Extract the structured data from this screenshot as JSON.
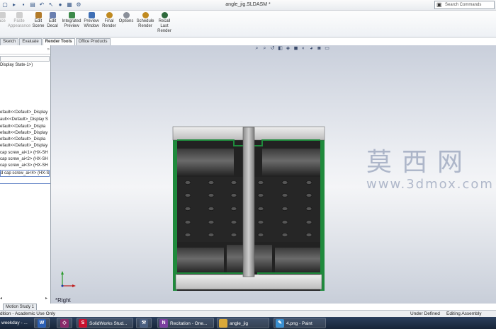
{
  "window": {
    "document_title": "angle_jig.SLDASM *",
    "search_placeholder": "Search Commands"
  },
  "ribbon": {
    "buttons": [
      {
        "label": "ace",
        "disabled": true
      },
      {
        "label": "Paste\nAppearance",
        "disabled": true
      },
      {
        "label": "Edit\nScene",
        "disabled": false
      },
      {
        "label": "Edit\nDecal",
        "disabled": false
      },
      {
        "label": "Integrated\nPreview",
        "disabled": false
      },
      {
        "label": "Preview\nWindow",
        "disabled": false
      },
      {
        "label": "Final\nRender",
        "disabled": false
      },
      {
        "label": "Options",
        "disabled": false
      },
      {
        "label": "Schedule\nRender",
        "disabled": false
      },
      {
        "label": "Recall\nLast\nRender",
        "disabled": false
      }
    ]
  },
  "tabs": [
    "Sketch",
    "Evaluate",
    "Render Tools",
    "Office Products"
  ],
  "active_tab": "Render Tools",
  "feature_tree": {
    "display_state": "Display State-1>)",
    "items": [
      "efault<<Default>_Display",
      "ault<<Default>_Display S",
      "efault<<Default>_Displa",
      "efault<<Default>_Display",
      "efault<<Default>_Displa",
      "efault<<Default>_Display",
      "cap screw_ai<1> (HX-SH",
      "cap screw_ai<2> (HX-SH",
      "cap screw_ai<3> (HX-SH"
    ],
    "selected_item": "d cap screw_ai<4> (HX-S"
  },
  "viewport": {
    "view_name": "*Right",
    "watermark_cn": "莫西网",
    "watermark_url": "www.3dmox.com"
  },
  "bottom_tabs": {
    "motion_study": "Motion Study 1"
  },
  "statusbar": {
    "left": "dition - Academic Use Only",
    "middle": "Under Defined",
    "right": "Editing Assembly"
  },
  "taskbar": [
    {
      "label": "weekday - ...",
      "icon": "notepad-icon"
    },
    {
      "label": "",
      "icon": "word-icon"
    },
    {
      "label": "",
      "icon": "app-icon"
    },
    {
      "label": "SolidWorks Stud...",
      "icon": "solidworks-icon"
    },
    {
      "label": "",
      "icon": "hammer-icon"
    },
    {
      "label": "Recitation - One...",
      "icon": "onenote-icon"
    },
    {
      "label": "angle_jig",
      "icon": "folder-icon"
    },
    {
      "label": "4.png - Paint",
      "icon": "paint-icon"
    }
  ],
  "colors": {
    "part_green": "#1f8a3c",
    "plate_gray": "#d9d9d9",
    "body_dark": "#2a2a2a",
    "taskbar_bg": "#1d2c44"
  }
}
